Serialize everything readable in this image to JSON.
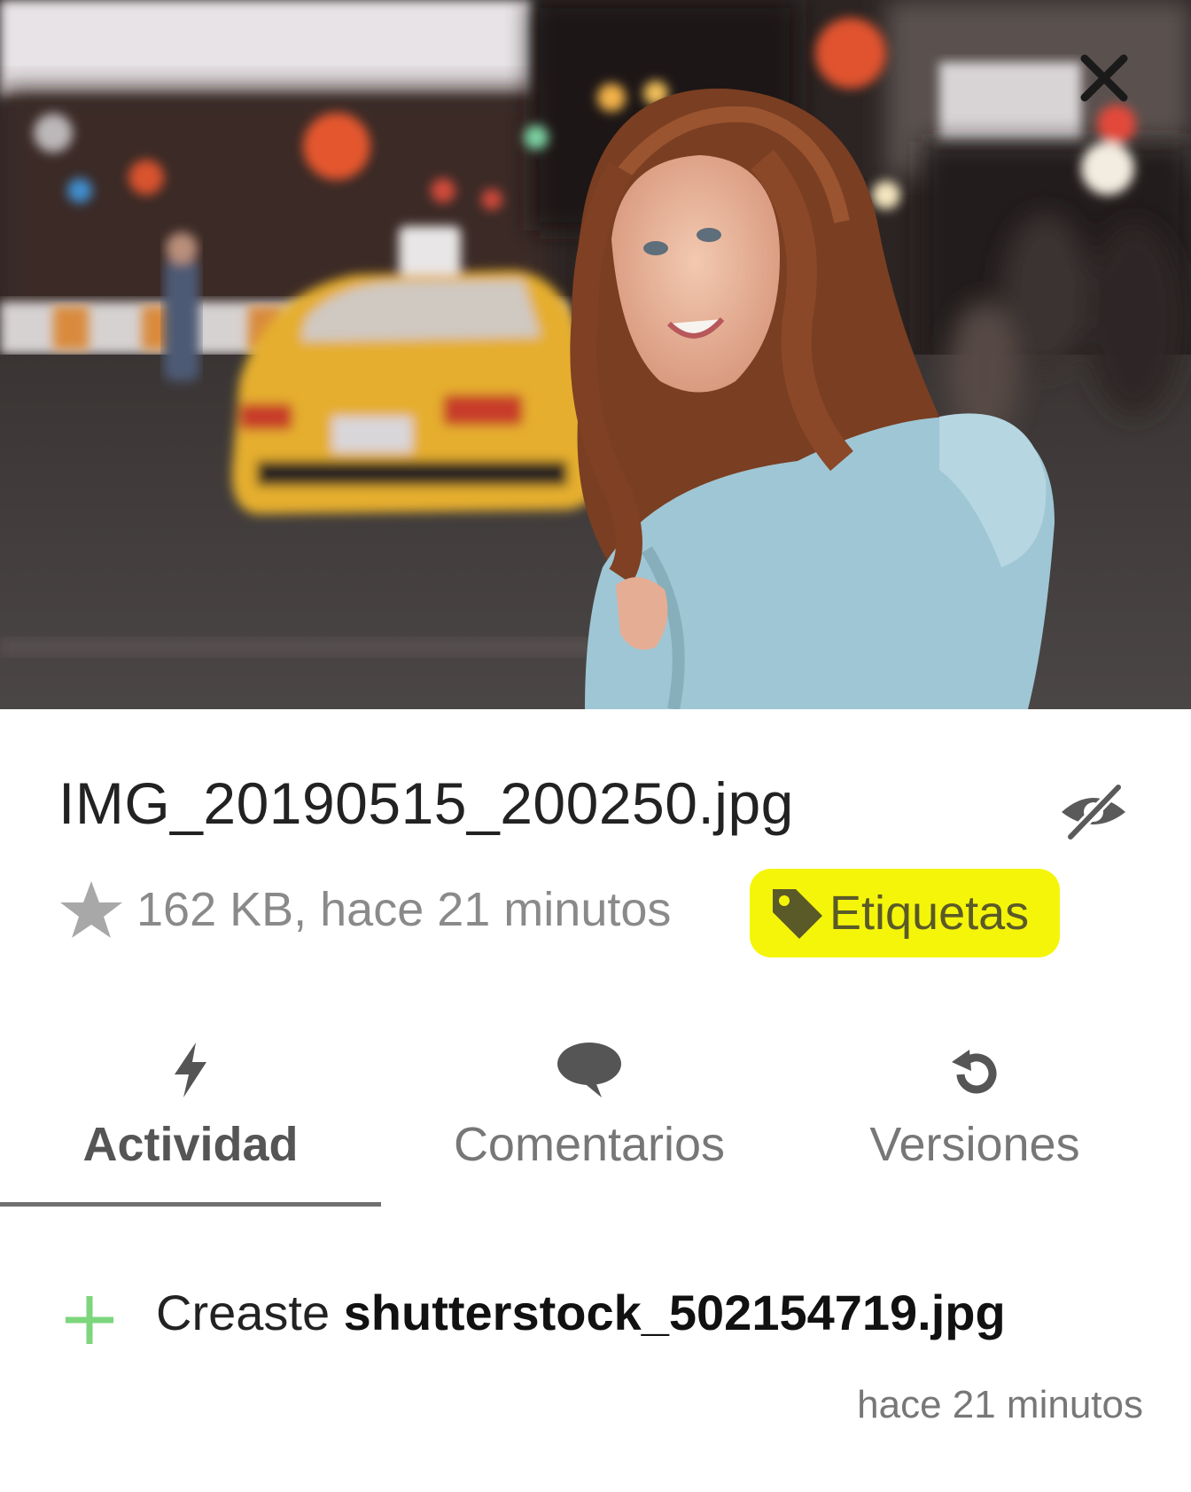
{
  "file": {
    "name": "IMG_20190515_200250.jpg",
    "meta": "162 KB, hace 21 minutos",
    "tags_label": "Etiquetas"
  },
  "icons": {
    "close": "close-icon",
    "hide": "eye-slash-icon",
    "favorite": "star-icon",
    "tag": "tag-icon",
    "activity": "bolt-icon",
    "comments": "speech-bubble-icon",
    "versions": "history-icon",
    "created": "plus-icon"
  },
  "tabs": [
    {
      "label": "Actividad",
      "active": true
    },
    {
      "label": "Comentarios",
      "active": false
    },
    {
      "label": "Versiones",
      "active": false
    }
  ],
  "activity": {
    "action": "Creaste",
    "target": "shutterstock_502154719.jpg",
    "time": "hace 21 minutos"
  },
  "colors": {
    "tag_highlight": "#f5f50a",
    "created_plus": "#7cd67c",
    "icon_gray": "#555555",
    "meta_gray": "#8a8a8a"
  }
}
